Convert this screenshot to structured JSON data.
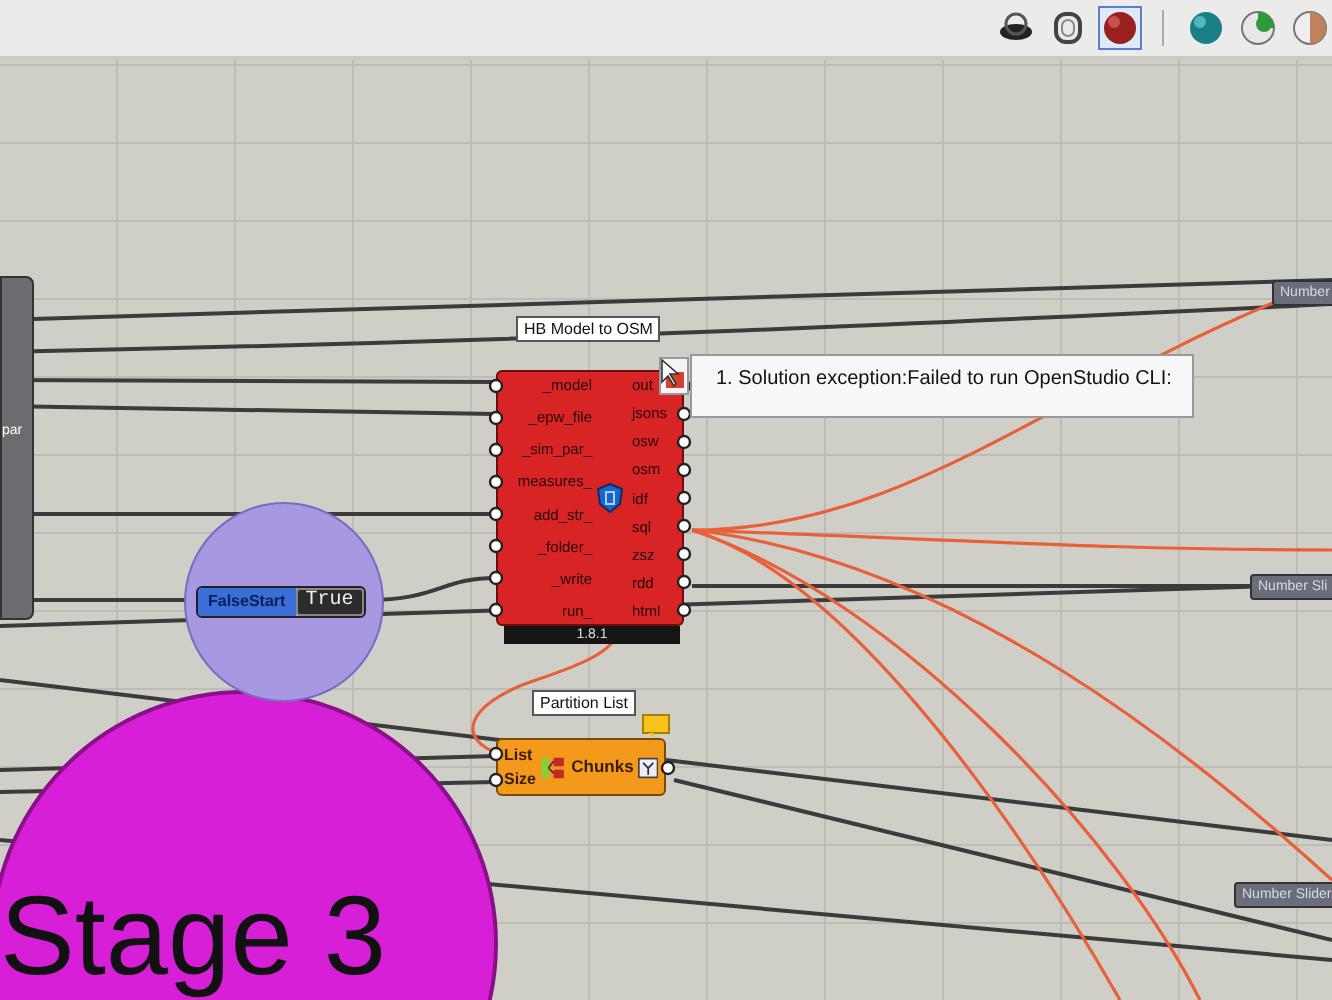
{
  "toolbar": {
    "icons": [
      {
        "kind": "eye",
        "selected": false
      },
      {
        "kind": "ring",
        "selected": false
      },
      {
        "kind": "red-sphere",
        "selected": true
      },
      {
        "kind": "teal-sphere",
        "selected": false
      },
      {
        "kind": "green-sphere",
        "selected": false
      },
      {
        "kind": "white-sphere",
        "selected": false
      }
    ]
  },
  "canvas": {
    "left_component": {
      "label": "par"
    },
    "toggle": {
      "name": "FalseStart",
      "value": "True"
    },
    "components": [
      {
        "kind": "hb",
        "title": "HB Model to OSM",
        "error": true,
        "inputs": [
          "_model",
          "_epw_file",
          "_sim_par_",
          "measures_",
          "add_str_",
          "_folder_",
          "_write",
          "run_"
        ],
        "outputs": [
          "out",
          "jsons",
          "osw",
          "osm",
          "idf",
          "sql",
          "zsz",
          "rdd",
          "html"
        ],
        "version": "1.8.1"
      },
      {
        "kind": "partition",
        "title": "Partition List",
        "warning": true,
        "inputs": [
          "List",
          "Size"
        ],
        "outputs": [
          "Chunks"
        ]
      }
    ],
    "error_tooltip": {
      "text": "1. Solution exception:Failed to run OpenStudio CLI:"
    },
    "sliders": [
      {
        "label": "Number"
      },
      {
        "label": "Number Sli"
      },
      {
        "label": "Number Slider"
      }
    ],
    "group_label": "Stage 3"
  }
}
